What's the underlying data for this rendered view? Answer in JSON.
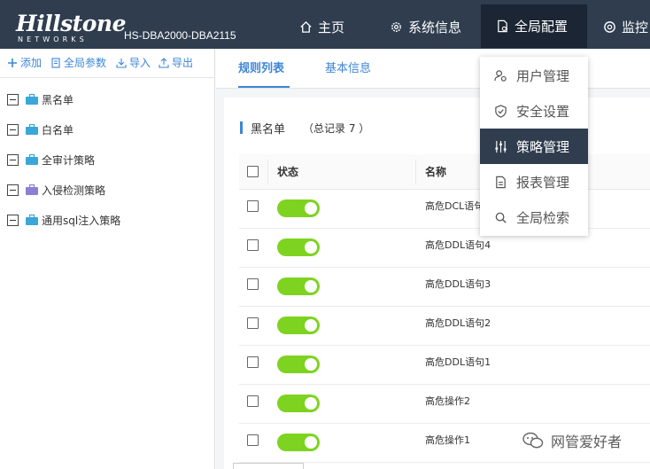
{
  "header": {
    "brand": "Hillstone",
    "brand_sub": "NETWORKS",
    "device_name": "HS-DBA2000-DBA2115",
    "nav": [
      {
        "label": "主页",
        "icon": "home-icon"
      },
      {
        "label": "系统信息",
        "icon": "gear-icon"
      },
      {
        "label": "全局配置",
        "icon": "config-doc-icon",
        "active": true
      },
      {
        "label": "监控",
        "icon": "monitor-icon"
      }
    ]
  },
  "dropdown": {
    "items": [
      {
        "label": "用户管理",
        "icon": "user-manage-icon"
      },
      {
        "label": "安全设置",
        "icon": "shield-check-icon"
      },
      {
        "label": "策略管理",
        "icon": "sliders-icon",
        "active": true
      },
      {
        "label": "报表管理",
        "icon": "report-doc-icon"
      },
      {
        "label": "全局检索",
        "icon": "search-icon"
      }
    ]
  },
  "sidebar": {
    "toolbar": [
      {
        "label": "添加",
        "icon": "plus-icon"
      },
      {
        "label": "全局参数",
        "icon": "doc-icon"
      },
      {
        "label": "导入",
        "icon": "import-icon"
      },
      {
        "label": "导出",
        "icon": "export-icon"
      }
    ],
    "tree": [
      {
        "label": "黑名单",
        "icon": "briefcase-icon",
        "color": "#3aa7d8"
      },
      {
        "label": "白名单",
        "icon": "briefcase-icon",
        "color": "#3aa7d8"
      },
      {
        "label": "全审计策略",
        "icon": "briefcase-icon",
        "color": "#3aa7d8"
      },
      {
        "label": "入侵检测策略",
        "icon": "briefcase-icon",
        "color": "#8e7fd6"
      },
      {
        "label": "通用sql注入策略",
        "icon": "briefcase-icon",
        "color": "#3aa7d8"
      }
    ]
  },
  "tabs": [
    {
      "label": "规则列表",
      "active": true
    },
    {
      "label": "基本信息"
    }
  ],
  "list": {
    "title": "黑名单",
    "count_text": "（总记录 7 ）",
    "columns": {
      "status": "状态",
      "name": "名称"
    },
    "rows": [
      {
        "enabled": true,
        "name": "高危DCL语句"
      },
      {
        "enabled": true,
        "name": "高危DDL语句4"
      },
      {
        "enabled": true,
        "name": "高危DDL语句3"
      },
      {
        "enabled": true,
        "name": "高危DDL语句2"
      },
      {
        "enabled": true,
        "name": "高危DDL语句1"
      },
      {
        "enabled": true,
        "name": "高危操作2"
      },
      {
        "enabled": true,
        "name": "高危操作1"
      }
    ]
  },
  "watermark": "网管爱好者",
  "colors": {
    "header_bg": "#2f3d4f",
    "accent": "#3d86d6",
    "toggle_on": "#7ed321"
  }
}
